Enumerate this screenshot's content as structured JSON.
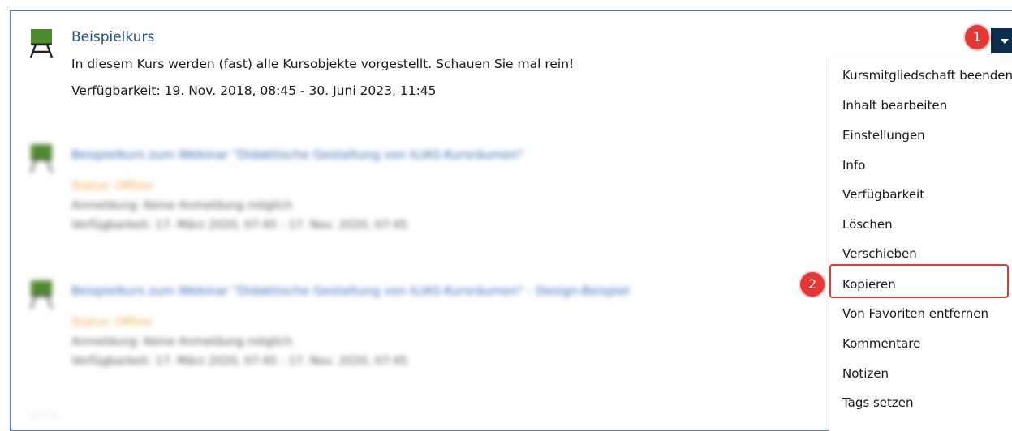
{
  "course": {
    "title": "Beispielkurs",
    "description": "In diesem Kurs werden (fast) alle Kursobjekte vorgestellt. Schauen Sie mal rein!",
    "availability": "Verfügbarkeit: 19. Nov. 2018, 08:45 - 30. Juni 2023, 11:45"
  },
  "blurred_items": [
    {
      "title": "Beispielkurs zum Webinar \"Didaktische Gestaltung von ILIAS-Kursräumen\"",
      "status": "Status: Offline",
      "registration": "Anmeldung: Keine Anmeldung möglich",
      "availability": "Verfügbarkeit: 17. März 2020, 07:45 - 17. Nov. 2020, 07:45"
    },
    {
      "title": "Beispielkurs zum Webinar \"Didaktische Gestaltung von ILIAS-Kursräumen\" - Design-Beispiel",
      "status": "Status: Offline",
      "registration": "Anmeldung: Keine Anmeldung möglich",
      "availability": "Verfügbarkeit: 17. März 2020, 07:45 - 17. Nov. 2020, 07:45"
    }
  ],
  "actions_menu": {
    "items": [
      "Kursmitgliedschaft beenden",
      "Inhalt bearbeiten",
      "Einstellungen",
      "Info",
      "Verfügbarkeit",
      "Löschen",
      "Verschieben",
      "Kopieren",
      "Von Favoriten entfernen",
      "Kommentare",
      "Notizen",
      "Tags setzen"
    ],
    "highlighted_item": "Kopieren"
  },
  "step_badges": [
    "1",
    "2"
  ],
  "colors": {
    "link": "#1a4f86",
    "toggle": "#0d2d4d",
    "badge": "#e53835",
    "frame": "#4a78c6",
    "offline_status": "#f0a64a"
  },
  "icons": {
    "course": "course-board-icon",
    "toggle": "caret-down-icon"
  }
}
